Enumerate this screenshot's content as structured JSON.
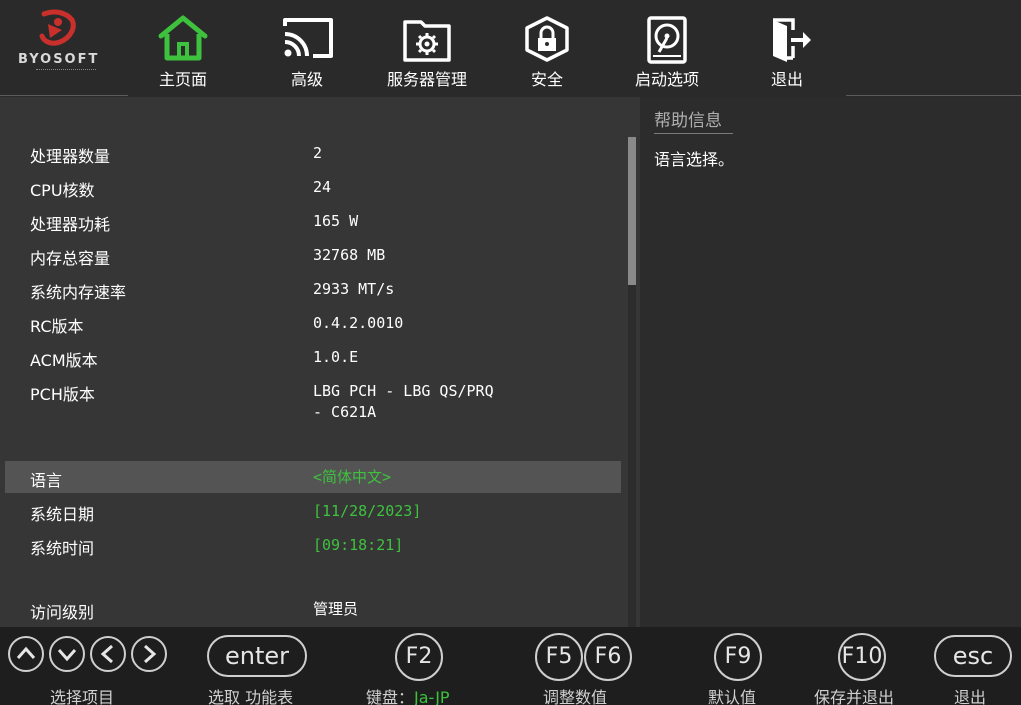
{
  "logo": {
    "brand": "BYOSOFT"
  },
  "tabs": [
    {
      "label": "主页面",
      "icon": "home-icon",
      "active": true
    },
    {
      "label": "高级",
      "icon": "cast-icon"
    },
    {
      "label": "服务器管理",
      "icon": "folder-gear-icon"
    },
    {
      "label": "安全",
      "icon": "lock-shield-icon"
    },
    {
      "label": "启动选项",
      "icon": "hard-disk-icon"
    },
    {
      "label": "退出",
      "icon": "exit-door-icon"
    }
  ],
  "info_rows": [
    {
      "label": "处理器数量",
      "value": "2"
    },
    {
      "label": "CPU核数",
      "value": "24"
    },
    {
      "label": "处理器功耗",
      "value": "165 W"
    },
    {
      "label": "内存总容量",
      "value": "32768 MB"
    },
    {
      "label": "系统内存速率",
      "value": "2933 MT/s"
    },
    {
      "label": "RC版本",
      "value": "0.4.2.0010"
    },
    {
      "label": "ACM版本",
      "value": "1.0.E"
    },
    {
      "label": "PCH版本",
      "value_line1": "LBG PCH - LBG QS/PRQ",
      "value_line2": "- C621A"
    }
  ],
  "settings_rows": [
    {
      "label": "语言",
      "value": "<简体中文>",
      "selected": true
    },
    {
      "label": "系统日期",
      "value": "[11/28/2023]"
    },
    {
      "label": "系统时间",
      "value": "[09:18:21]"
    }
  ],
  "access": {
    "label": "访问级别",
    "value": "管理员"
  },
  "help": {
    "title": "帮助信息",
    "text": "语言选择。"
  },
  "keys": {
    "enter": "enter",
    "f2": "F2",
    "f5": "F5",
    "f6": "F6",
    "f9": "F9",
    "f10": "F10",
    "esc": "esc"
  },
  "key_labels": {
    "select_item": "选择项目",
    "select_menu": "选取 功能表",
    "keyboard_prefix": "键盘：",
    "keyboard_value": "Ja-JP",
    "adjust": "调整数值",
    "default": "默认值",
    "save_exit": "保存并退出",
    "exit": "退出"
  },
  "colors": {
    "accent_green": "#3ec23e",
    "background": "#363636",
    "help_background": "#2c2c2c",
    "selected_row": "#545454"
  }
}
